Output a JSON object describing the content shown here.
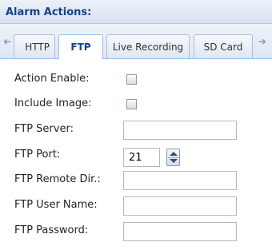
{
  "panel": {
    "title": "Alarm Actions:"
  },
  "tabs": [
    {
      "label": "HTTP",
      "active": false
    },
    {
      "label": "FTP",
      "active": true
    },
    {
      "label": "Live Recording",
      "active": false
    },
    {
      "label": "SD Card",
      "active": false
    }
  ],
  "scroll": {
    "left_icon": "arrow-left-icon",
    "right_icon": "arrow-right-icon"
  },
  "form": {
    "action_enable_label": "Action Enable:",
    "action_enable_checked": false,
    "include_image_label": "Include Image:",
    "include_image_checked": false,
    "ftp_server_label": "FTP Server:",
    "ftp_server_value": "",
    "ftp_port_label": "FTP Port:",
    "ftp_port_value": "21",
    "ftp_remote_dir_label": "FTP Remote Dir.:",
    "ftp_remote_dir_value": "",
    "ftp_user_name_label": "FTP User Name:",
    "ftp_user_name_value": "",
    "ftp_password_label": "FTP Password:",
    "ftp_password_value": ""
  }
}
